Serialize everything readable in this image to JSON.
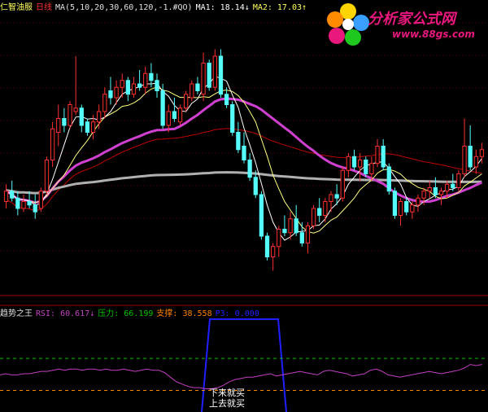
{
  "header": {
    "title": "仁智油服",
    "period": "日线",
    "ma_params": "MA(5,10,20,30,60,120,-1.#QO)",
    "ma1": "MA1: 18.14↓",
    "ma2": "MA2: 17.03↑"
  },
  "logo": {
    "title": "分析家公式网",
    "url": "www.88gs.com"
  },
  "indicator": {
    "name": "趋势之王",
    "rsi": "RSI: 60.617↓",
    "pressure": "压力: 66.199",
    "support": "支撑: 38.558",
    "p3": "P3: 0.000"
  },
  "annotations": {
    "down": "下来就买",
    "up": "上去就买"
  },
  "colors": {
    "up": "#ff3030",
    "down": "#54fcfc",
    "ma_white": "#ffffff",
    "ma_yellow": "#ffff80",
    "ma_magenta": "#d040d0",
    "ma_red": "#c00000",
    "ma_gray": "#b0b0b0",
    "rsi": "#c040c0",
    "pressure": "#00c000",
    "support": "#ff8000",
    "p3": "#2020ff"
  },
  "chart_data": {
    "type": "candlestick",
    "candles": [
      [
        15.6,
        16.1,
        15.4,
        15.9
      ],
      [
        15.9,
        16.2,
        15.6,
        15.7
      ],
      [
        15.7,
        15.9,
        15.2,
        15.4
      ],
      [
        15.4,
        15.8,
        15.3,
        15.6
      ],
      [
        15.6,
        15.9,
        15.4,
        15.5
      ],
      [
        15.5,
        15.8,
        15.1,
        15.3
      ],
      [
        15.4,
        16.0,
        15.3,
        15.9
      ],
      [
        15.9,
        16.9,
        15.8,
        16.8
      ],
      [
        16.8,
        17.9,
        16.6,
        17.7
      ],
      [
        17.6,
        18.4,
        17.2,
        18.0
      ],
      [
        18.0,
        18.3,
        17.6,
        17.8
      ],
      [
        17.8,
        18.5,
        17.7,
        18.4
      ],
      [
        18.2,
        19.8,
        18.1,
        18.3
      ],
      [
        18.3,
        18.4,
        17.6,
        17.8
      ],
      [
        17.9,
        18.0,
        17.5,
        17.6
      ],
      [
        17.6,
        18.1,
        17.4,
        17.9
      ],
      [
        17.9,
        18.4,
        17.7,
        18.2
      ],
      [
        18.2,
        18.9,
        18.0,
        18.7
      ],
      [
        18.8,
        19.2,
        18.4,
        18.6
      ],
      [
        18.6,
        19.1,
        18.4,
        18.9
      ],
      [
        18.9,
        19.3,
        18.6,
        19.1
      ],
      [
        19.1,
        19.2,
        18.5,
        18.7
      ],
      [
        18.7,
        19.2,
        18.6,
        19.0
      ],
      [
        19.0,
        19.4,
        18.8,
        18.9
      ],
      [
        18.9,
        19.5,
        18.7,
        19.3
      ],
      [
        19.3,
        19.6,
        18.9,
        19.1
      ],
      [
        19.1,
        19.3,
        18.6,
        18.8
      ],
      [
        18.8,
        19.0,
        17.7,
        17.8
      ],
      [
        17.8,
        18.4,
        17.6,
        18.2
      ],
      [
        18.2,
        18.6,
        17.9,
        18.0
      ],
      [
        17.9,
        18.4,
        17.8,
        18.3
      ],
      [
        18.3,
        18.8,
        18.2,
        18.7
      ],
      [
        18.6,
        19.1,
        18.5,
        19.0
      ],
      [
        19.0,
        19.2,
        18.7,
        18.8
      ],
      [
        18.7,
        19.9,
        18.5,
        19.6
      ],
      [
        19.6,
        19.7,
        18.8,
        18.9
      ],
      [
        18.9,
        20.0,
        18.8,
        19.8
      ],
      [
        19.8,
        20.0,
        18.6,
        18.7
      ],
      [
        18.7,
        18.9,
        18.3,
        18.4
      ],
      [
        18.4,
        18.5,
        17.5,
        17.6
      ],
      [
        17.6,
        17.9,
        17.0,
        17.1
      ],
      [
        17.2,
        17.6,
        16.7,
        16.8
      ],
      [
        16.8,
        17.0,
        16.2,
        16.3
      ],
      [
        16.3,
        16.5,
        15.7,
        15.8
      ],
      [
        15.8,
        15.9,
        14.5,
        14.6
      ],
      [
        14.6,
        14.7,
        13.9,
        14.0
      ],
      [
        14.0,
        14.4,
        13.6,
        14.3
      ],
      [
        14.3,
        14.9,
        14.0,
        14.8
      ],
      [
        14.8,
        15.2,
        14.6,
        14.7
      ],
      [
        14.7,
        15.3,
        14.5,
        15.1
      ],
      [
        15.1,
        15.5,
        14.6,
        14.7
      ],
      [
        14.7,
        15.0,
        14.3,
        14.4
      ],
      [
        14.4,
        15.0,
        14.1,
        14.9
      ],
      [
        14.9,
        15.5,
        14.8,
        15.4
      ],
      [
        15.4,
        15.7,
        15.0,
        15.2
      ],
      [
        15.2,
        15.7,
        15.0,
        15.6
      ],
      [
        15.6,
        15.9,
        15.3,
        15.8
      ],
      [
        15.8,
        16.1,
        15.5,
        15.7
      ],
      [
        15.7,
        16.6,
        15.6,
        16.5
      ],
      [
        16.5,
        17.0,
        16.3,
        16.9
      ],
      [
        16.9,
        17.1,
        16.5,
        16.6
      ],
      [
        16.6,
        17.0,
        16.2,
        16.8
      ],
      [
        16.8,
        16.9,
        16.3,
        16.4
      ],
      [
        16.4,
        16.9,
        16.2,
        16.7
      ],
      [
        16.7,
        17.4,
        16.6,
        17.2
      ],
      [
        17.2,
        17.4,
        16.5,
        16.6
      ],
      [
        16.6,
        16.7,
        15.8,
        15.9
      ],
      [
        15.9,
        16.0,
        15.1,
        15.2
      ],
      [
        15.2,
        15.7,
        14.9,
        15.6
      ],
      [
        15.6,
        15.7,
        15.2,
        15.3
      ],
      [
        15.3,
        15.6,
        15.1,
        15.5
      ],
      [
        15.5,
        15.8,
        15.3,
        15.7
      ],
      [
        15.7,
        16.0,
        15.5,
        15.9
      ],
      [
        15.9,
        16.2,
        15.7,
        16.0
      ],
      [
        16.0,
        16.3,
        15.7,
        15.8
      ],
      [
        15.8,
        16.0,
        15.5,
        15.9
      ],
      [
        15.9,
        16.2,
        15.7,
        16.1
      ],
      [
        16.1,
        16.4,
        15.9,
        16.0
      ],
      [
        16.0,
        16.5,
        15.9,
        16.4
      ],
      [
        16.4,
        18.0,
        16.3,
        17.2
      ],
      [
        17.2,
        17.8,
        16.5,
        16.6
      ],
      [
        16.6,
        17.1,
        16.4,
        16.9
      ],
      [
        16.9,
        17.3,
        16.7,
        17.1
      ]
    ],
    "ylim": [
      13,
      21
    ],
    "indicator": {
      "rsi": [
        52,
        53,
        52,
        52,
        53,
        53,
        54,
        55,
        55,
        56,
        57,
        56,
        57,
        57,
        56,
        57,
        57,
        56,
        57,
        56,
        56,
        57,
        56,
        55,
        56,
        57,
        56,
        56,
        54,
        50,
        46,
        44,
        42,
        41,
        41,
        40,
        40,
        41,
        43,
        46,
        48,
        49,
        50,
        50,
        51,
        52,
        53,
        51,
        52,
        53,
        54,
        55,
        54,
        53,
        52,
        55,
        56,
        55,
        54,
        53,
        51,
        52,
        53,
        56,
        57,
        55,
        52,
        51,
        50,
        51,
        52,
        53,
        54,
        55,
        54,
        53,
        54,
        55,
        56,
        58,
        61,
        60,
        61
      ],
      "pressure": 66.199,
      "support": 38.558,
      "ylim": [
        20,
        100
      ]
    }
  }
}
